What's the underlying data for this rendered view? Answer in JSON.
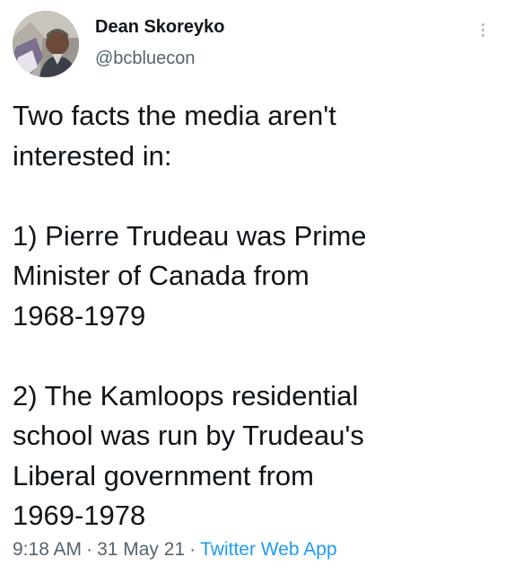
{
  "author": {
    "display_name": "Dean Skoreyko",
    "handle": "@bcbluecon"
  },
  "tweet": {
    "lines_intro": [
      "Two facts the media aren't",
      "interested in:"
    ],
    "lines_fact1": [
      "1) Pierre Trudeau was Prime",
      "Minister of Canada from",
      "1968-1979"
    ],
    "lines_fact2": [
      "2) The Kamloops residential",
      "school was run by Trudeau's",
      "Liberal government from",
      "1969-1978"
    ]
  },
  "meta": {
    "time": "9:18 AM",
    "separator": "·",
    "date": "31 May 21",
    "client": "Twitter Web App"
  },
  "colors": {
    "text": "#0f1419",
    "secondary": "#536471",
    "link": "#1d9bf0"
  },
  "icons": {
    "more": "more-vertical-icon"
  }
}
